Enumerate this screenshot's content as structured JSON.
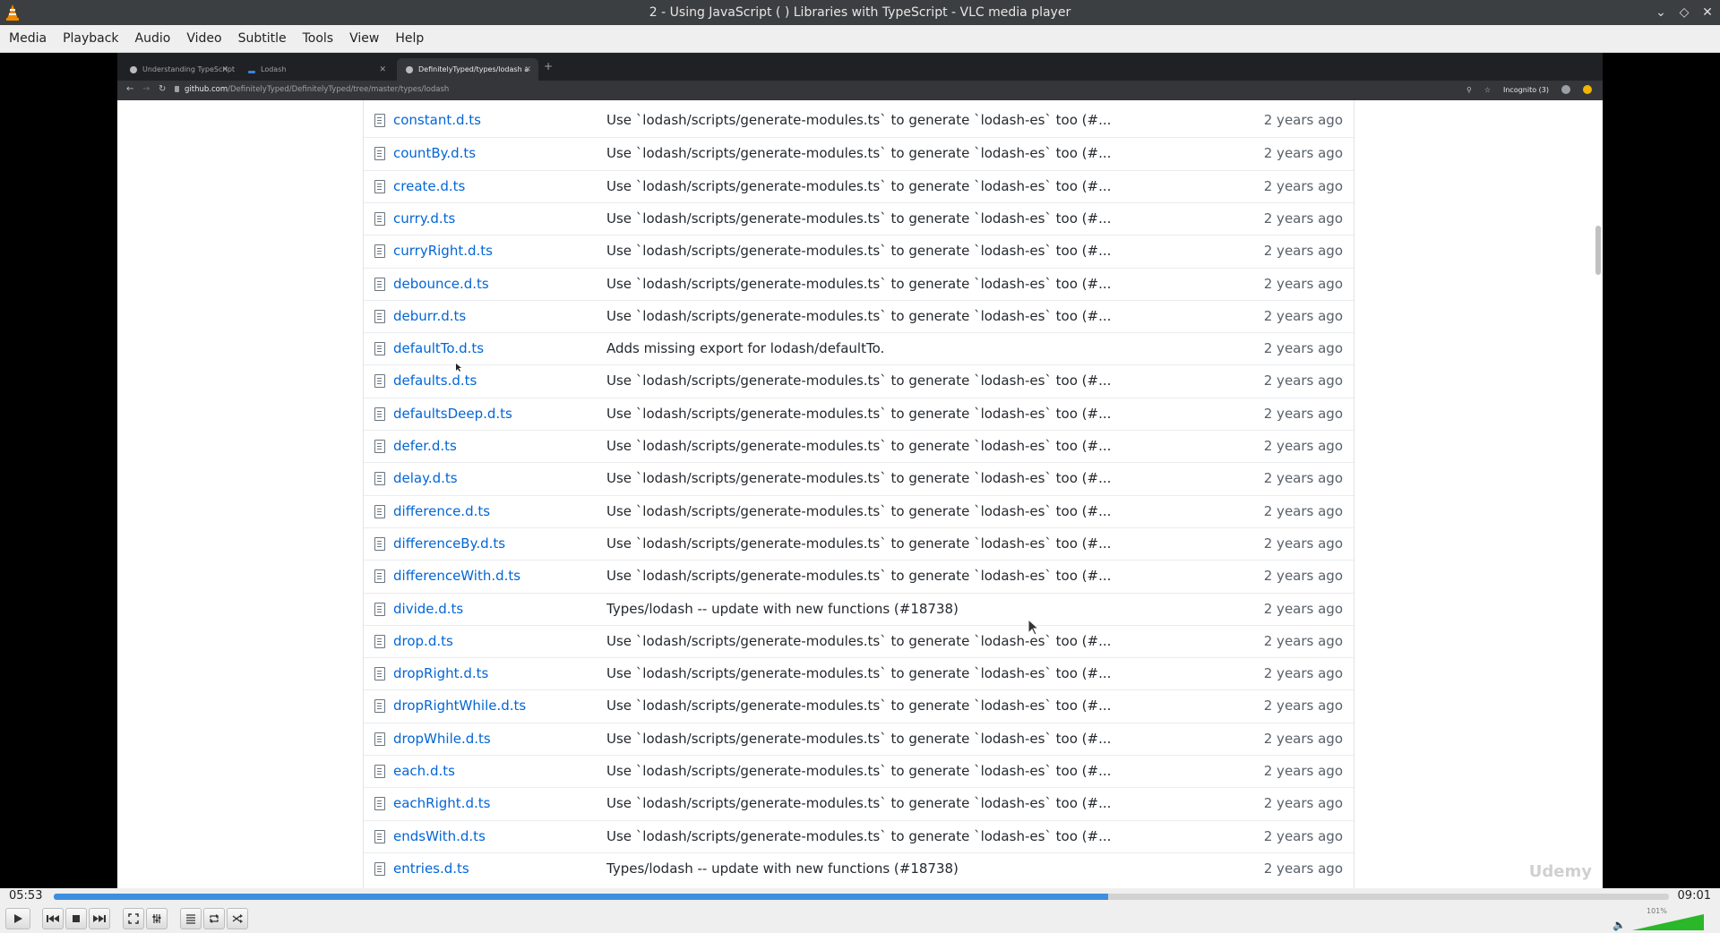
{
  "window": {
    "title": "2 - Using JavaScript ( ) Libraries with TypeScript - VLC media player",
    "controls": [
      "minimize",
      "restore",
      "close"
    ]
  },
  "menubar": {
    "items": [
      "Media",
      "Playback",
      "Audio",
      "Video",
      "Subtitle",
      "Tools",
      "View",
      "Help"
    ]
  },
  "browser": {
    "tabs": [
      {
        "label": "Understanding TypeScript"
      },
      {
        "label": "Lodash"
      },
      {
        "label": "DefinitelyTyped/types/lodash a"
      }
    ],
    "url_host": "github.com",
    "url_path": "/DefinitelyTyped/DefinitelyTyped/tree/master/types/lodash",
    "incognito_label": "Incognito (3)"
  },
  "files": [
    {
      "name": "constant.d.ts",
      "message": "Use `lodash/scripts/generate-modules.ts` to generate `lodash-es` too (#...",
      "age": "2 years ago"
    },
    {
      "name": "countBy.d.ts",
      "message": "Use `lodash/scripts/generate-modules.ts` to generate `lodash-es` too (#...",
      "age": "2 years ago"
    },
    {
      "name": "create.d.ts",
      "message": "Use `lodash/scripts/generate-modules.ts` to generate `lodash-es` too (#...",
      "age": "2 years ago"
    },
    {
      "name": "curry.d.ts",
      "message": "Use `lodash/scripts/generate-modules.ts` to generate `lodash-es` too (#...",
      "age": "2 years ago"
    },
    {
      "name": "curryRight.d.ts",
      "message": "Use `lodash/scripts/generate-modules.ts` to generate `lodash-es` too (#...",
      "age": "2 years ago"
    },
    {
      "name": "debounce.d.ts",
      "message": "Use `lodash/scripts/generate-modules.ts` to generate `lodash-es` too (#...",
      "age": "2 years ago"
    },
    {
      "name": "deburr.d.ts",
      "message": "Use `lodash/scripts/generate-modules.ts` to generate `lodash-es` too (#...",
      "age": "2 years ago"
    },
    {
      "name": "defaultTo.d.ts",
      "message": "Adds missing export for lodash/defaultTo.",
      "age": "2 years ago"
    },
    {
      "name": "defaults.d.ts",
      "message": "Use `lodash/scripts/generate-modules.ts` to generate `lodash-es` too (#...",
      "age": "2 years ago"
    },
    {
      "name": "defaultsDeep.d.ts",
      "message": "Use `lodash/scripts/generate-modules.ts` to generate `lodash-es` too (#...",
      "age": "2 years ago"
    },
    {
      "name": "defer.d.ts",
      "message": "Use `lodash/scripts/generate-modules.ts` to generate `lodash-es` too (#...",
      "age": "2 years ago"
    },
    {
      "name": "delay.d.ts",
      "message": "Use `lodash/scripts/generate-modules.ts` to generate `lodash-es` too (#...",
      "age": "2 years ago"
    },
    {
      "name": "difference.d.ts",
      "message": "Use `lodash/scripts/generate-modules.ts` to generate `lodash-es` too (#...",
      "age": "2 years ago"
    },
    {
      "name": "differenceBy.d.ts",
      "message": "Use `lodash/scripts/generate-modules.ts` to generate `lodash-es` too (#...",
      "age": "2 years ago"
    },
    {
      "name": "differenceWith.d.ts",
      "message": "Use `lodash/scripts/generate-modules.ts` to generate `lodash-es` too (#...",
      "age": "2 years ago"
    },
    {
      "name": "divide.d.ts",
      "message": "Types/lodash -- update with new functions (#18738)",
      "age": "2 years ago"
    },
    {
      "name": "drop.d.ts",
      "message": "Use `lodash/scripts/generate-modules.ts` to generate `lodash-es` too (#...",
      "age": "2 years ago"
    },
    {
      "name": "dropRight.d.ts",
      "message": "Use `lodash/scripts/generate-modules.ts` to generate `lodash-es` too (#...",
      "age": "2 years ago"
    },
    {
      "name": "dropRightWhile.d.ts",
      "message": "Use `lodash/scripts/generate-modules.ts` to generate `lodash-es` too (#...",
      "age": "2 years ago"
    },
    {
      "name": "dropWhile.d.ts",
      "message": "Use `lodash/scripts/generate-modules.ts` to generate `lodash-es` too (#...",
      "age": "2 years ago"
    },
    {
      "name": "each.d.ts",
      "message": "Use `lodash/scripts/generate-modules.ts` to generate `lodash-es` too (#...",
      "age": "2 years ago"
    },
    {
      "name": "eachRight.d.ts",
      "message": "Use `lodash/scripts/generate-modules.ts` to generate `lodash-es` too (#...",
      "age": "2 years ago"
    },
    {
      "name": "endsWith.d.ts",
      "message": "Use `lodash/scripts/generate-modules.ts` to generate `lodash-es` too (#...",
      "age": "2 years ago"
    },
    {
      "name": "entries.d.ts",
      "message": "Types/lodash -- update with new functions (#18738)",
      "age": "2 years ago"
    }
  ],
  "watermark": "Udemy",
  "player": {
    "time_elapsed": "05:53",
    "time_total": "09:01",
    "progress_fraction": 0.653,
    "volume_label": "101%",
    "volume_fraction": 1.0,
    "colors": {
      "seek_fill": "#3d8ee0",
      "volume_fill": "#2ab72a"
    },
    "buttons": [
      "play-icon",
      "previous-icon",
      "stop-icon",
      "next-icon",
      "fullscreen-icon",
      "extended-settings-icon",
      "playlist-icon",
      "loop-icon",
      "shuffle-icon"
    ]
  }
}
